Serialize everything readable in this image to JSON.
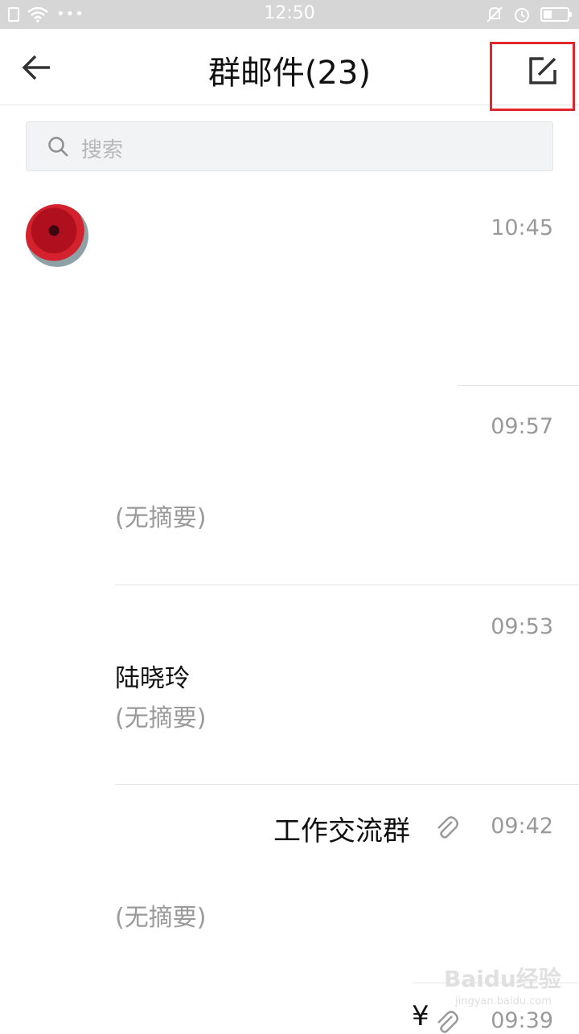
{
  "status_bar": {
    "time": "12:50",
    "dots": "•••"
  },
  "header": {
    "title": "群邮件(23)"
  },
  "search": {
    "placeholder": "搜索"
  },
  "mails": [
    {
      "time": "10:45",
      "sender": "",
      "summary": ""
    },
    {
      "time": "09:57",
      "sender": "",
      "summary": "(无摘要)"
    },
    {
      "time": "09:53",
      "sender": "陆晓玲",
      "summary": "(无摘要)"
    },
    {
      "time": "09:42",
      "subject": "工作交流群",
      "summary": "(无摘要)"
    },
    {
      "time": "09:39",
      "subject": "¥"
    }
  ],
  "watermark": {
    "main": "Baidu经验",
    "sub": "jingyan.baidu.com"
  }
}
